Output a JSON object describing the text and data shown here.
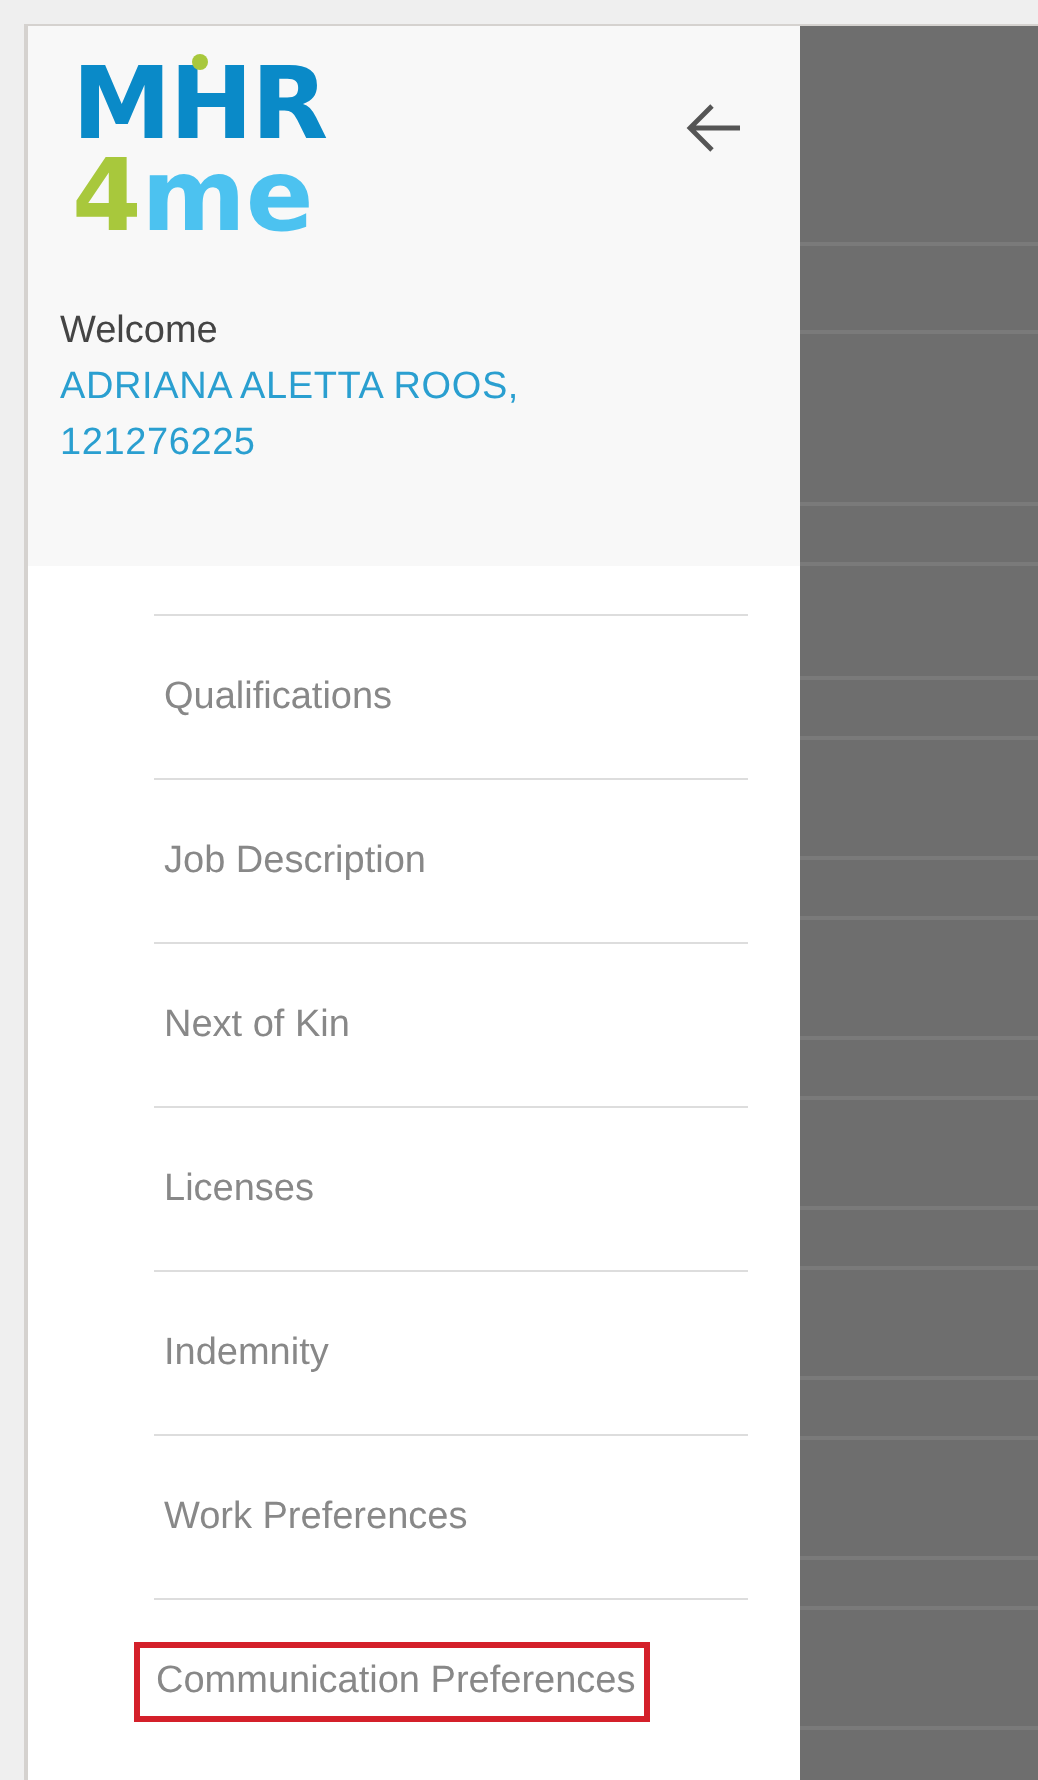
{
  "logo": {
    "top": "MHR",
    "digit": "4",
    "rest": "me"
  },
  "welcome": {
    "label": "Welcome",
    "user": "ADRIANA ALETTA ROOS,",
    "id": "121276225"
  },
  "menu": [
    {
      "label": "Qualifications",
      "highlighted": false
    },
    {
      "label": "Job Description",
      "highlighted": false
    },
    {
      "label": "Next of Kin",
      "highlighted": false
    },
    {
      "label": "Licenses",
      "highlighted": false
    },
    {
      "label": "Indemnity",
      "highlighted": false
    },
    {
      "label": "Work Preferences",
      "highlighted": false
    },
    {
      "label": "Communication Preferences",
      "highlighted": true
    }
  ]
}
